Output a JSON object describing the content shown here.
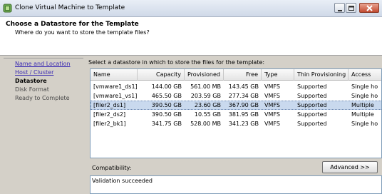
{
  "window": {
    "title": "Clone Virtual Machine to Template"
  },
  "header": {
    "title": "Choose a Datastore for the Template",
    "subtitle": "Where do you want to store the template files?"
  },
  "sidebar": {
    "items": [
      {
        "label": "Name and Location",
        "state": "link"
      },
      {
        "label": "Host / Cluster",
        "state": "link"
      },
      {
        "label": "Datastore",
        "state": "current"
      },
      {
        "label": "Disk Format",
        "state": "disabled"
      },
      {
        "label": "Ready to Complete",
        "state": "disabled"
      }
    ]
  },
  "main": {
    "prompt": "Select a datastore in which to store the files for the template:",
    "table": {
      "columns": [
        "Name",
        "Capacity",
        "Provisioned",
        "Free",
        "Type",
        "Thin Provisioning",
        "Access"
      ],
      "rows": [
        [
          "[vmware1_ds1]",
          "144.00 GB",
          "561.00 MB",
          "143.45 GB",
          "VMFS",
          "Supported",
          "Single ho"
        ],
        [
          "[vmware1_vs1]",
          "465.50 GB",
          "203.59 GB",
          "277.34 GB",
          "VMFS",
          "Supported",
          "Single ho"
        ],
        [
          "[filer2_ds1]",
          "390.50 GB",
          "23.60 GB",
          "367.90 GB",
          "VMFS",
          "Supported",
          "Multiple"
        ],
        [
          "[filer2_ds2]",
          "390.50 GB",
          "10.55 GB",
          "381.95 GB",
          "VMFS",
          "Supported",
          "Multiple"
        ],
        [
          "[filer2_bk1]",
          "341.75 GB",
          "528.00 MB",
          "341.23 GB",
          "VMFS",
          "Supported",
          "Single ho"
        ]
      ],
      "selected_row": 2
    },
    "compatibility_label": "Compatibility:",
    "advanced_button": "Advanced >>",
    "validation_text": "Validation succeeded"
  },
  "colors": {
    "selected_row": "#c9d9ee",
    "link": "#3b2bb3",
    "close_button": "#c24a31"
  },
  "icons": [
    "vm-app-icon",
    "minimize-icon",
    "maximize-icon",
    "close-icon"
  ]
}
